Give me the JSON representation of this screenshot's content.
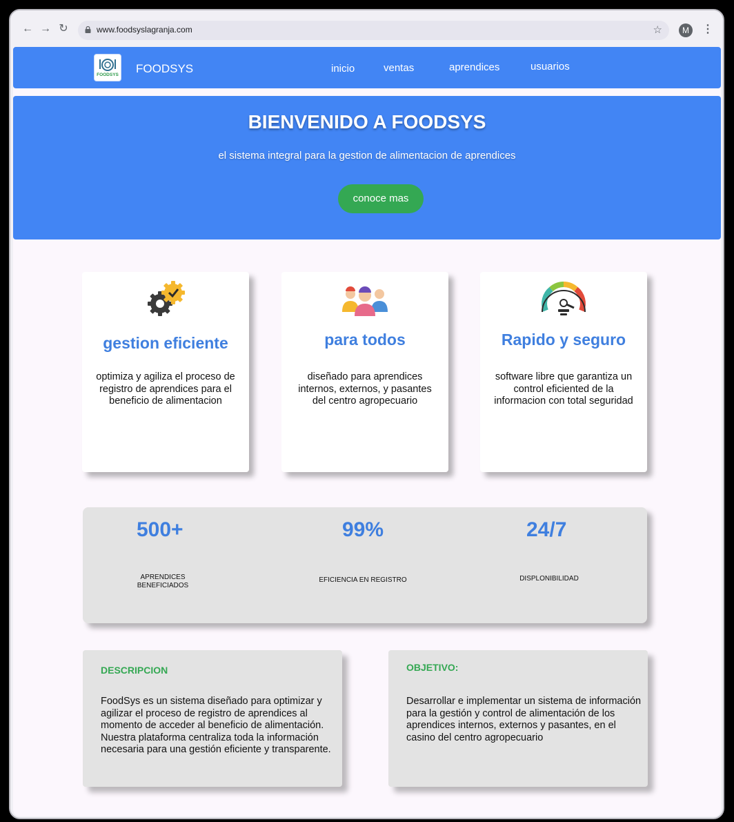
{
  "browser": {
    "url": "www.foodsyslagranja.com",
    "profile_initial": "M",
    "icons": [
      "back-arrow-icon",
      "forward-arrow-icon",
      "reload-icon",
      "lock-icon",
      "star-icon",
      "kebab-menu-icon"
    ]
  },
  "navbar": {
    "brand": "FOODSYS",
    "logo_text": "FOODSYS",
    "links": [
      "inicio",
      "ventas",
      "aprendices",
      "usuarios"
    ],
    "color": "#4285f4"
  },
  "hero": {
    "title": "BIENVENIDO A FOODSYS",
    "subtitle": "el sistema integral para la gestion de alimentacion de aprendices",
    "button": "conoce mas",
    "button_color": "#34a853"
  },
  "features": [
    {
      "icon": "gears-check-icon",
      "title": "gestion eficiente",
      "text": "optimiza y agiliza el proceso de registro de aprendices para el beneficio de alimentacion"
    },
    {
      "icon": "people-group-icon",
      "title": "para todos",
      "text": "diseñado para aprendices internos, externos, y pasantes del centro agropecuario"
    },
    {
      "icon": "speedometer-icon",
      "title": "Rapido y seguro",
      "text": "software libre que garantiza un control eficiented de la informacion con total seguridad"
    }
  ],
  "stats": [
    {
      "value": "500+",
      "label": "APRENDICES BENEFICIADOS"
    },
    {
      "value": "99%",
      "label": "EFICIENCIA EN REGISTRO"
    },
    {
      "value": "24/7",
      "label": "DISPLONIBILIDAD"
    }
  ],
  "description": {
    "heading": "DESCRIPCION",
    "text": "FoodSys es un sistema diseñado para optimizar y agilizar el proceso de registro de aprendices al momento de acceder al beneficio de alimentación. Nuestra plataforma centraliza toda la información necesaria para una gestión eficiente y transparente."
  },
  "objective": {
    "heading": "OBJETIVO:",
    "text": "Desarrollar e implementar un sistema de información para la gestión y control de alimentación de los aprendices internos, externos y pasantes, en el casino del centro agropecuario"
  }
}
